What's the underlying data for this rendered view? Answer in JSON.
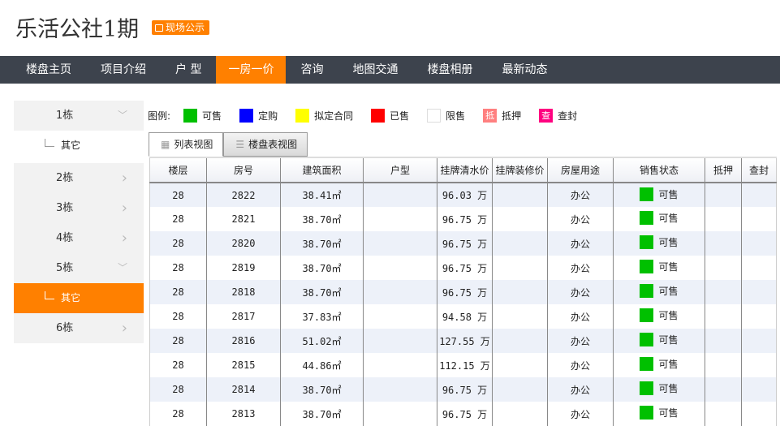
{
  "title": "乐活公社1期",
  "badge": "现场公示",
  "nav": [
    "楼盘主页",
    "项目介绍",
    "户 型",
    "一房一价",
    "咨询",
    "地图交通",
    "楼盘相册",
    "最新动态"
  ],
  "active_nav": 3,
  "sidebar": [
    {
      "label": "1栋",
      "type": "item",
      "chev": "down"
    },
    {
      "label": "其它",
      "type": "sub"
    },
    {
      "label": "2栋",
      "type": "item",
      "chev": "right"
    },
    {
      "label": "3栋",
      "type": "item",
      "chev": "right"
    },
    {
      "label": "4栋",
      "type": "item",
      "chev": "right"
    },
    {
      "label": "5栋",
      "type": "item",
      "chev": "down"
    },
    {
      "label": "其它",
      "type": "sub",
      "active": true
    },
    {
      "label": "6栋",
      "type": "item",
      "chev": "right"
    }
  ],
  "legend": {
    "label": "图例:",
    "items": [
      {
        "label": "可售",
        "color": "#00c000",
        "mark": ""
      },
      {
        "label": "定购",
        "color": "#0000ff",
        "mark": ""
      },
      {
        "label": "拟定合同",
        "color": "#ffff00",
        "mark": ""
      },
      {
        "label": "已售",
        "color": "#ff0000",
        "mark": ""
      },
      {
        "label": "限售",
        "color": "#ffffff",
        "mark": ""
      },
      {
        "label": "抵押",
        "color": "#ff8080",
        "mark": "抵"
      },
      {
        "label": "查封",
        "color": "#ff0080",
        "mark": "查"
      }
    ]
  },
  "tabs": [
    "列表视图",
    "楼盘表视图"
  ],
  "columns": [
    "楼层",
    "房号",
    "建筑面积",
    "户型",
    "挂牌清水价",
    "挂牌装修价",
    "房屋用途",
    "销售状态",
    "抵押",
    "查封"
  ],
  "rows": [
    [
      "28",
      "2822",
      "38.41㎡",
      "",
      "96.03 万",
      "",
      "办公",
      "可售",
      "",
      ""
    ],
    [
      "28",
      "2821",
      "38.70㎡",
      "",
      "96.75 万",
      "",
      "办公",
      "可售",
      "",
      ""
    ],
    [
      "28",
      "2820",
      "38.70㎡",
      "",
      "96.75 万",
      "",
      "办公",
      "可售",
      "",
      ""
    ],
    [
      "28",
      "2819",
      "38.70㎡",
      "",
      "96.75 万",
      "",
      "办公",
      "可售",
      "",
      ""
    ],
    [
      "28",
      "2818",
      "38.70㎡",
      "",
      "96.75 万",
      "",
      "办公",
      "可售",
      "",
      ""
    ],
    [
      "28",
      "2817",
      "37.83㎡",
      "",
      "94.58 万",
      "",
      "办公",
      "可售",
      "",
      ""
    ],
    [
      "28",
      "2816",
      "51.02㎡",
      "",
      "127.55 万",
      "",
      "办公",
      "可售",
      "",
      ""
    ],
    [
      "28",
      "2815",
      "44.86㎡",
      "",
      "112.15 万",
      "",
      "办公",
      "可售",
      "",
      ""
    ],
    [
      "28",
      "2814",
      "38.70㎡",
      "",
      "96.75 万",
      "",
      "办公",
      "可售",
      "",
      ""
    ],
    [
      "28",
      "2813",
      "38.70㎡",
      "",
      "96.75 万",
      "",
      "办公",
      "可售",
      "",
      ""
    ]
  ]
}
